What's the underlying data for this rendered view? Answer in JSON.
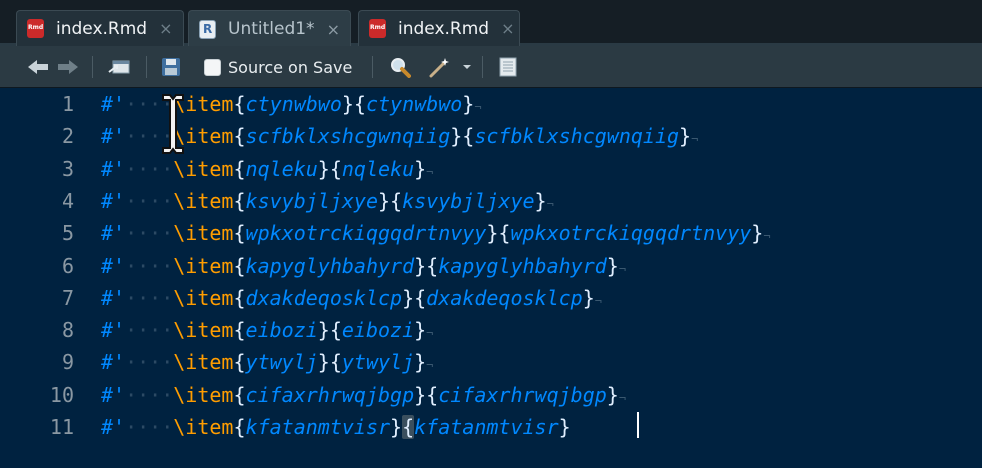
{
  "tabs": [
    {
      "label": "index.Rmd",
      "icon": "rmd-file-icon",
      "active": false
    },
    {
      "label": "Untitled1*",
      "icon": "r-script-icon",
      "active": true
    },
    {
      "label": "index.Rmd",
      "icon": "rmd-file-icon",
      "active": false
    }
  ],
  "tab_close_glyph": "×",
  "toolbar": {
    "source_on_save_label": "Source on Save",
    "source_on_save_checked": false
  },
  "editor": {
    "comment_prefix": "#'",
    "command": "\\item",
    "lines": [
      {
        "num": "1",
        "arg1": "ctynwbwo",
        "arg2": "ctynwbwo"
      },
      {
        "num": "2",
        "arg1": "scfbklxshcgwnqiig",
        "arg2": "scfbklxshcgwnqiig"
      },
      {
        "num": "3",
        "arg1": "nqleku",
        "arg2": "nqleku"
      },
      {
        "num": "4",
        "arg1": "ksvybjljxye",
        "arg2": "ksvybjljxye"
      },
      {
        "num": "5",
        "arg1": "wpkxotrckiqgqdrtnvyy",
        "arg2": "wpkxotrckiqgqdrtnvyy"
      },
      {
        "num": "6",
        "arg1": "kapyglyhbahyrd",
        "arg2": "kapyglyhbahyrd"
      },
      {
        "num": "7",
        "arg1": "dxakdeqosklcp",
        "arg2": "dxakdeqosklcp"
      },
      {
        "num": "8",
        "arg1": "eibozi",
        "arg2": "eibozi"
      },
      {
        "num": "9",
        "arg1": "ytwylj",
        "arg2": "ytwylj"
      },
      {
        "num": "10",
        "arg1": "cifaxrhrwqjbgp",
        "arg2": "cifaxrhrwqjbgp"
      },
      {
        "num": "11",
        "arg1": "kfatanmtvisr",
        "arg2": "kfatanmtvisr"
      }
    ]
  },
  "colors": {
    "editor_bg": "#002240",
    "comment": "#0088ff",
    "keyword": "#ff9d00",
    "brace": "#e1efff",
    "line_number": "#8a98a3"
  }
}
